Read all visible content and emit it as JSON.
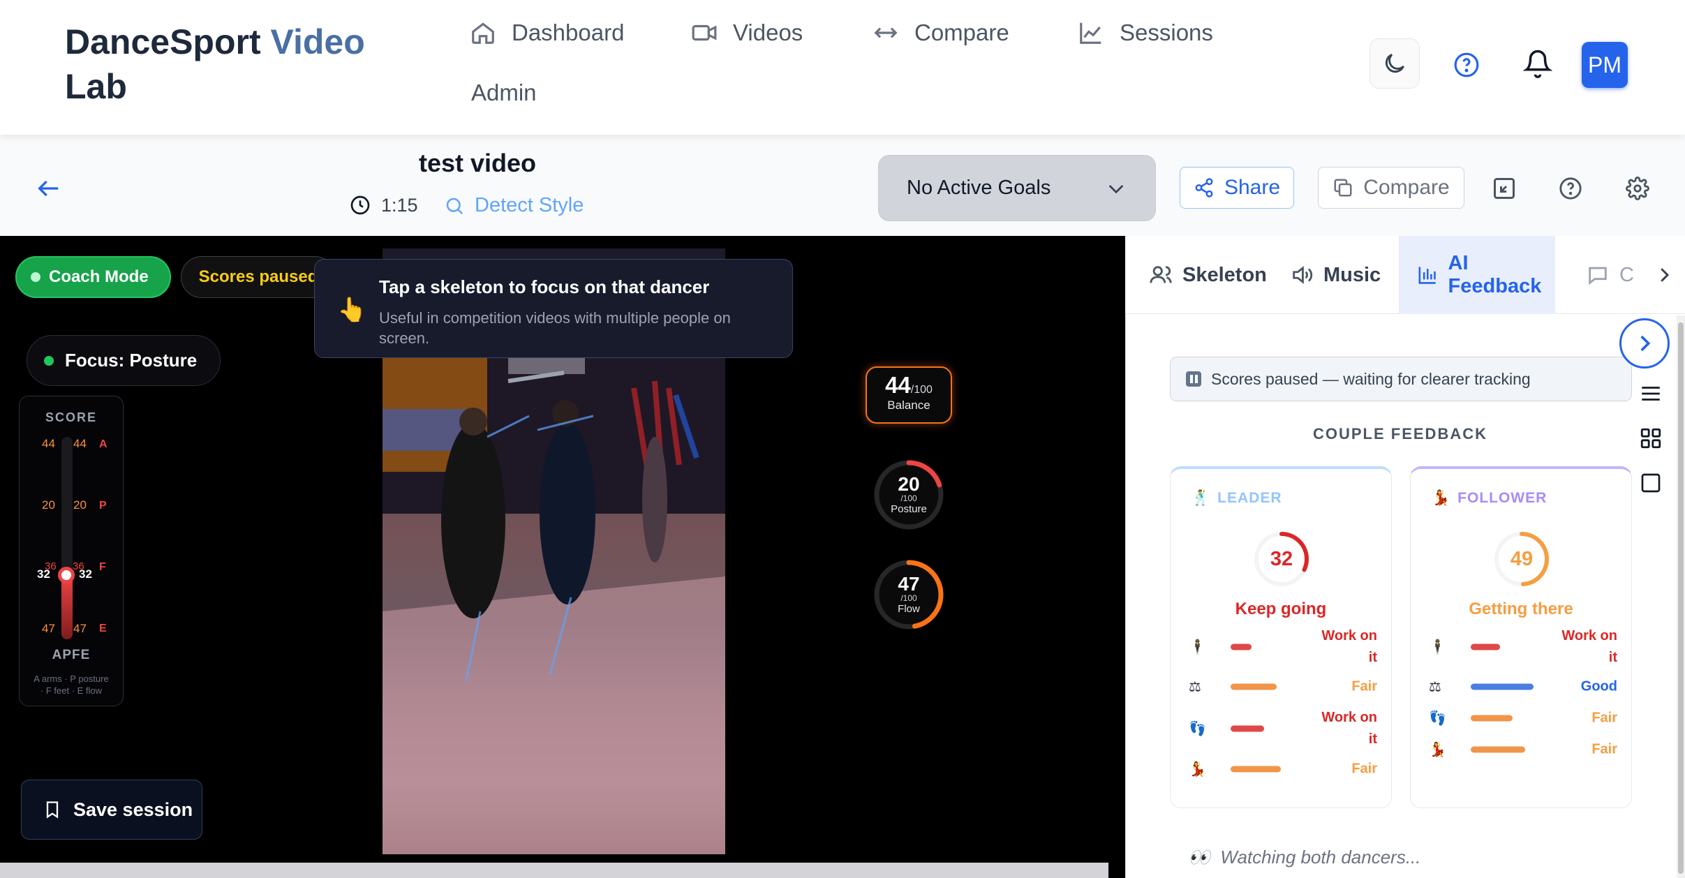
{
  "brand": {
    "name": "DanceSport",
    "accent": "Video",
    "line2": "Lab"
  },
  "nav": [
    {
      "label": "Dashboard",
      "icon": "home-icon"
    },
    {
      "label": "Videos",
      "icon": "video-icon"
    },
    {
      "label": "Compare",
      "icon": "arrows-icon"
    },
    {
      "label": "Sessions",
      "icon": "chart-icon"
    },
    {
      "label": "Admin"
    }
  ],
  "user": {
    "initials": "PM"
  },
  "video": {
    "title": "test video",
    "duration": "1:15",
    "detect_label": "Detect Style"
  },
  "toolbar": {
    "goals": "No Active Goals",
    "share": "Share",
    "compare": "Compare"
  },
  "overlay": {
    "coach_mode": "Coach Mode",
    "scores_paused": "Scores paused",
    "focus": "Focus: Posture",
    "tooltip_title": "Tap a skeleton to focus on that dancer",
    "tooltip_body": "Useful in competition videos with multiple people on screen.",
    "save_session": "Save session"
  },
  "scorebox": {
    "header": "SCORE",
    "rows": [
      {
        "left": "44",
        "right": "44",
        "letter": "A"
      },
      {
        "left": "20",
        "right": "20",
        "letter": "P"
      },
      {
        "left": "36",
        "right": "36",
        "letter": "F"
      },
      {
        "left": "47",
        "right": "47",
        "letter": "E"
      }
    ],
    "current_left": "32",
    "current_right": "32",
    "title": "APFE",
    "legend1": "A arms · P posture",
    "legend2": "· F feet · E flow"
  },
  "metrics": {
    "balance": {
      "value": "44",
      "max": "/100",
      "label": "Balance"
    },
    "posture": {
      "value": "20",
      "max": "/100",
      "label": "Posture",
      "fraction": 0.2
    },
    "flow": {
      "value": "47",
      "max": "/100",
      "label": "Flow",
      "fraction": 0.47
    }
  },
  "panel": {
    "tabs": [
      {
        "label": "Skeleton",
        "icon": "person-icon"
      },
      {
        "label": "Music",
        "icon": "speaker-icon"
      },
      {
        "label": "AI Feedback",
        "icon": "bar-chart-icon",
        "active": true
      },
      {
        "label": "C",
        "icon": "chat-icon"
      }
    ],
    "banner": "Scores paused — waiting for clearer tracking",
    "section": "COUPLE FEEDBACK",
    "leader": {
      "role": "LEADER",
      "score": "32",
      "fraction": 0.32,
      "status": "Keep going",
      "rows": [
        {
          "icon": "🕴",
          "label_l1": "Work on",
          "label_l2": "it",
          "level": 0.25,
          "tone": "red"
        },
        {
          "icon": "⚖",
          "label_l1": "Fair",
          "level": 0.55,
          "tone": "orange"
        },
        {
          "icon": "👣",
          "label_l1": "Work on",
          "label_l2": "it",
          "level": 0.4,
          "tone": "red"
        },
        {
          "icon": "💃",
          "label_l1": "Fair",
          "level": 0.6,
          "tone": "orange"
        }
      ]
    },
    "follower": {
      "role": "FOLLOWER",
      "score": "49",
      "fraction": 0.49,
      "status": "Getting there",
      "rows": [
        {
          "icon": "🕴",
          "label_l1": "Work on",
          "label_l2": "it",
          "level": 0.35,
          "tone": "red"
        },
        {
          "icon": "⚖",
          "label_l1": "Good",
          "level": 0.75,
          "tone": "blue"
        },
        {
          "icon": "👣",
          "label_l1": "Fair",
          "level": 0.5,
          "tone": "orange"
        },
        {
          "icon": "💃",
          "label_l1": "Fair",
          "level": 0.65,
          "tone": "orange"
        }
      ]
    },
    "watching": "Watching both dancers..."
  },
  "colors": {
    "accent": "#2563eb",
    "coach": "#16a34a",
    "paused": "#facc15",
    "warning": "#f97316",
    "danger": "#ef4444"
  }
}
